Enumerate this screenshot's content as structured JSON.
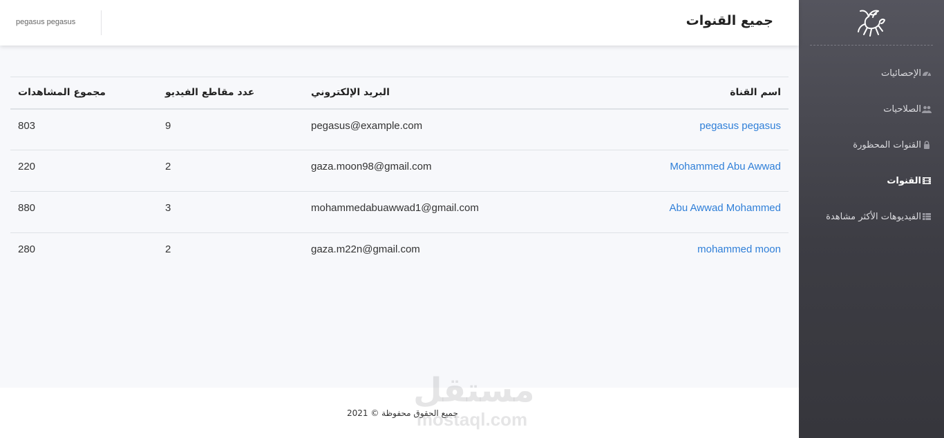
{
  "header": {
    "title": "جميع القنوات",
    "user_name": "pegasus pegasus"
  },
  "sidebar": {
    "items": [
      {
        "label": "الإحصائيات",
        "icon": "dashboard-icon",
        "active": false
      },
      {
        "label": "الصلاحيات",
        "icon": "users-icon",
        "active": false
      },
      {
        "label": "القنوات المحظورة",
        "icon": "lock-icon",
        "active": false
      },
      {
        "label": "القنوات",
        "icon": "film-icon",
        "active": true
      },
      {
        "label": "الفيديوهات الأكثر مشاهدة",
        "icon": "table-icon",
        "active": false
      }
    ]
  },
  "table": {
    "columns": [
      "اسم القناة",
      "البريد الإلكتروني",
      "عدد مقاطع الفيديو",
      "مجموع المشاهدات"
    ],
    "rows": [
      {
        "name": "pegasus pegasus",
        "email": "pegasus@example.com",
        "videos": "9",
        "views": "803"
      },
      {
        "name": "Mohammed Abu Awwad",
        "email": "gaza.moon98@gmail.com",
        "videos": "2",
        "views": "220"
      },
      {
        "name": "Abu Awwad Mohammed",
        "email": "mohammedabuawwad1@gmail.com",
        "videos": "3",
        "views": "880"
      },
      {
        "name": "mohammed moon",
        "email": "gaza.m22n@gmail.com",
        "videos": "2",
        "views": "280"
      }
    ]
  },
  "footer": {
    "copyright": "جميع الحقوق محفوظة © 2021"
  },
  "watermark": {
    "arabic": "مستقل",
    "latin": "mostaql.com"
  },
  "colors": {
    "link": "#2f7fd8",
    "sidebar_top": "#55555e",
    "sidebar_bottom": "#36363c",
    "background": "#f7f8fb"
  }
}
